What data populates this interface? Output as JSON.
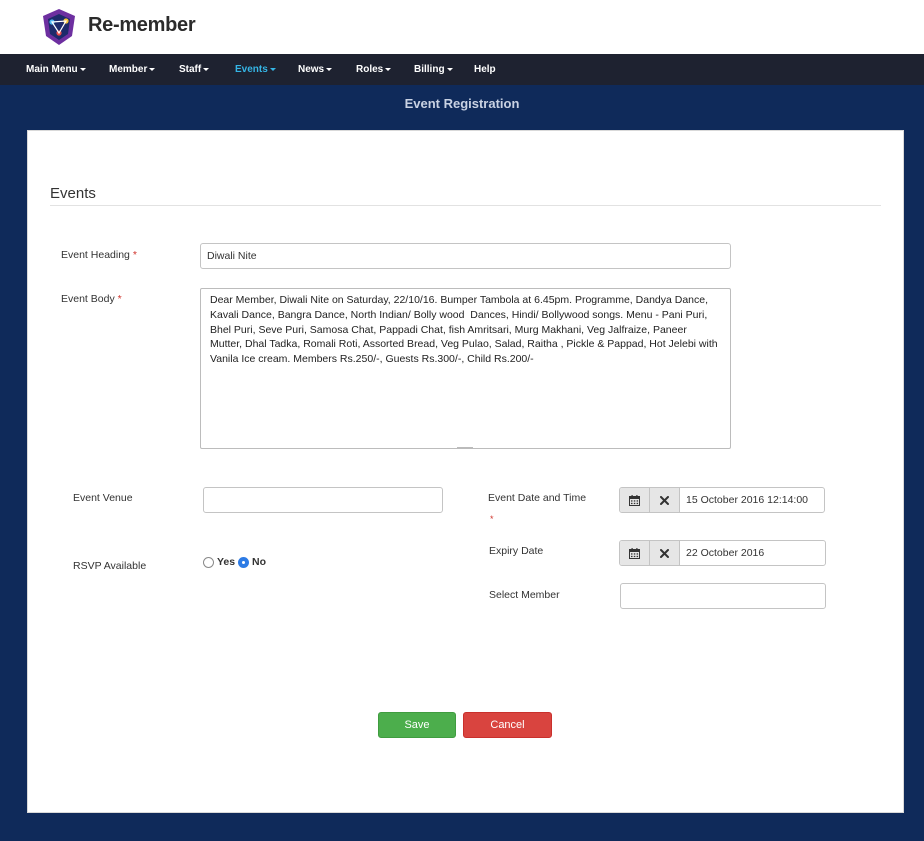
{
  "brand": {
    "name": "Re-member",
    "logo_icon": "re-member-logo-icon"
  },
  "nav": {
    "items": [
      {
        "label": "Main Menu",
        "dropdown": true,
        "active": false
      },
      {
        "label": "Member",
        "dropdown": true,
        "active": false
      },
      {
        "label": "Staff",
        "dropdown": true,
        "active": false
      },
      {
        "label": "Events",
        "dropdown": true,
        "active": true
      },
      {
        "label": "News",
        "dropdown": true,
        "active": false
      },
      {
        "label": "Roles",
        "dropdown": true,
        "active": false
      },
      {
        "label": "Billing",
        "dropdown": true,
        "active": false
      },
      {
        "label": "Help",
        "dropdown": false,
        "active": false
      }
    ]
  },
  "page": {
    "title": "Event Registration"
  },
  "form": {
    "section_title": "Events",
    "required_marker": "*",
    "event_heading": {
      "label": "Event Heading",
      "required": true,
      "value": "Diwali Nite"
    },
    "event_body": {
      "label": "Event Body",
      "required": true,
      "value": "Dear Member, Diwali Nite on Saturday, 22/10/16. Bumper Tambola at 6.45pm. Programme, Dandya Dance, Kavali Dance, Bangra Dance, North Indian/ Bolly wood  Dances, Hindi/ Bollywood songs. Menu - Pani Puri, Bhel Puri, Seve Puri, Samosa Chat, Pappadi Chat, fish Amritsari, Murg Makhani, Veg Jalfraize, Paneer Mutter, Dhal Tadka, Romali Roti, Assorted Bread, Veg Pulao, Salad, Raitha , Pickle & Pappad, Hot Jelebi with Vanila Ice cream. Members Rs.250/-, Guests Rs.300/-, Child Rs.200/-"
    },
    "event_venue": {
      "label": "Event Venue",
      "value": ""
    },
    "rsvp": {
      "label": "RSVP Available",
      "options": [
        {
          "label": "Yes",
          "checked": false
        },
        {
          "label": "No",
          "checked": true
        }
      ]
    },
    "event_date_time": {
      "label": "Event Date and Time",
      "required": true,
      "value": "15 October 2016 12:14:00",
      "calendar_icon": "calendar-icon",
      "clear_icon": "close-icon"
    },
    "expiry_date": {
      "label": "Expiry Date",
      "value": "22 October 2016",
      "calendar_icon": "calendar-icon",
      "clear_icon": "close-icon"
    },
    "select_member": {
      "label": "Select Member",
      "value": ""
    },
    "save_label": "Save",
    "cancel_label": "Cancel"
  },
  "colors": {
    "page_background": "#0f2a5a",
    "nav_background": "#1e2230",
    "nav_active": "#35b5e5",
    "save_button": "#4cae4c",
    "cancel_button": "#d9443f",
    "required": "#d0342c"
  }
}
